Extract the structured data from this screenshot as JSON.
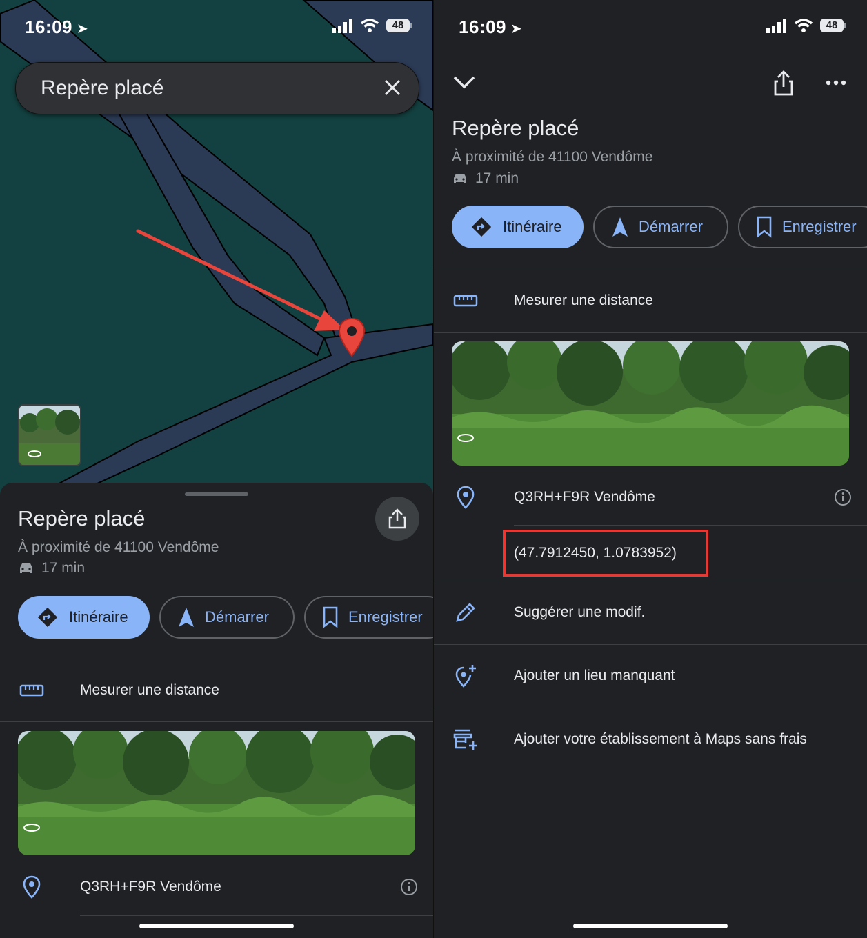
{
  "status": {
    "time": "16:09",
    "battery": "48"
  },
  "search": {
    "query": "Repère placé"
  },
  "place": {
    "title": "Repère placé",
    "nearby": "À proximité de 41100 Vendôme",
    "eta": "17 min"
  },
  "actions": {
    "directions": "Itinéraire",
    "start": "Démarrer",
    "save": "Enregistrer"
  },
  "rows": {
    "measure": "Mesurer une distance",
    "pluscode": "Q3RH+F9R Vendôme",
    "coords": "(47.7912450, 1.0783952)",
    "suggest": "Suggérer une modif.",
    "add_place": "Ajouter un lieu manquant",
    "add_business": "Ajouter votre établissement à Maps sans frais"
  },
  "colors": {
    "map_bg": "#134040",
    "road": "#2b3a55",
    "accent": "#8ab4f8",
    "pin": "#e8453c",
    "highlight": "#e53935"
  },
  "icons": [
    "location-arrow-icon",
    "signal-icon",
    "wifi-icon",
    "battery-icon",
    "close-icon",
    "share-icon",
    "directions-icon",
    "navigation-icon",
    "bookmark-icon",
    "ruler-icon",
    "pin-icon",
    "info-icon",
    "pencil-icon",
    "add-place-icon",
    "add-business-icon",
    "chevron-down-icon",
    "more-icon",
    "car-icon",
    "streetview-icon"
  ]
}
